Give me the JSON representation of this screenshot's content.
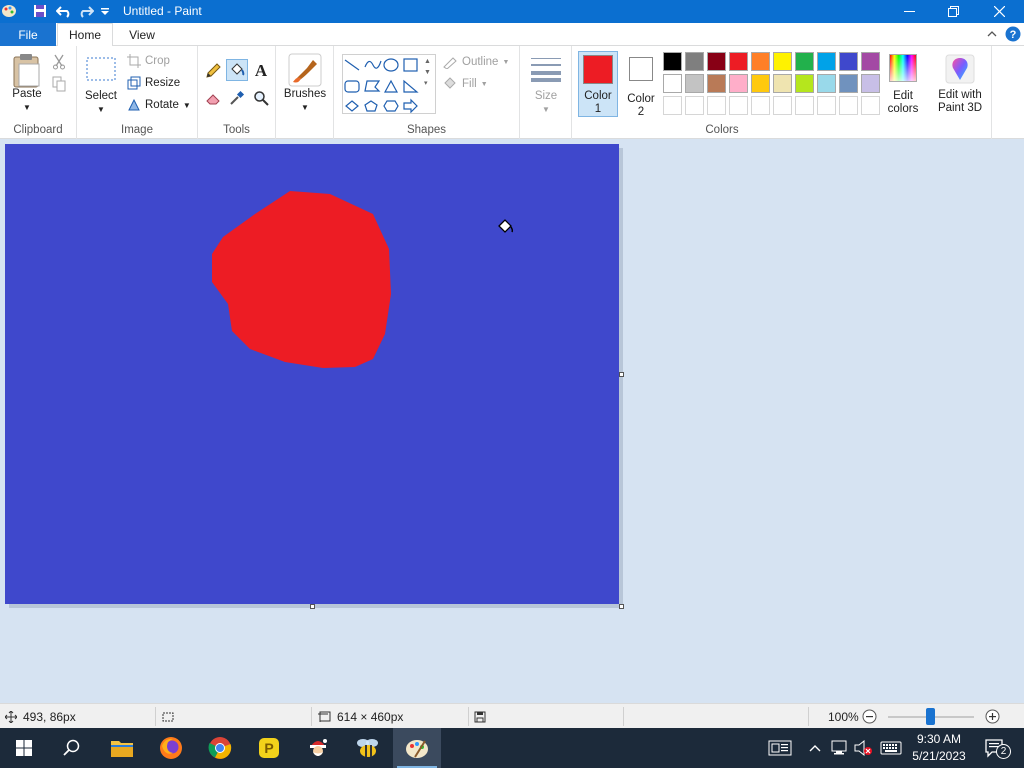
{
  "window": {
    "title": "Untitled - Paint"
  },
  "tabs": {
    "file": "File",
    "home": "Home",
    "view": "View"
  },
  "ribbon": {
    "clipboard": {
      "paste": "Paste",
      "label": "Clipboard"
    },
    "image": {
      "select": "Select",
      "crop": "Crop",
      "resize": "Resize",
      "rotate": "Rotate",
      "label": "Image"
    },
    "tools": {
      "label": "Tools",
      "selected_tool": "fill-bucket"
    },
    "brushes": {
      "label": "Brushes"
    },
    "shapes": {
      "outline": "Outline",
      "fill": "Fill",
      "label": "Shapes"
    },
    "size": {
      "label": "Size"
    },
    "colors": {
      "color1_line1": "Color",
      "color1_line2": "1",
      "color2_line1": "Color",
      "color2_line2": "2",
      "color1": "#ed1c24",
      "color2": "#ffffff",
      "edit_line1": "Edit",
      "edit_line2": "colors",
      "paint3d_line1": "Edit with",
      "paint3d_line2": "Paint 3D",
      "label": "Colors",
      "palette_row1": [
        "#000000",
        "#7f7f7f",
        "#880015",
        "#ed1c24",
        "#ff7f27",
        "#fff200",
        "#22b14c",
        "#00a2e8",
        "#3f48cc",
        "#a349a4"
      ],
      "palette_row2": [
        "#ffffff",
        "#c3c3c3",
        "#b97a57",
        "#ffaec9",
        "#ffc90e",
        "#efe4b0",
        "#b5e61d",
        "#99d9ea",
        "#7092be",
        "#c8bfe7"
      ]
    }
  },
  "canvas": {
    "background": "#3f48cc",
    "blob_color": "#ed1c24"
  },
  "status": {
    "cursor_pos": "493, 86px",
    "canvas_size": "614 × 460px",
    "zoom": "100%",
    "zoom_level": 1.0
  },
  "taskbar": {
    "time": "9:30 AM",
    "date": "5/21/2023",
    "notifications": "2"
  }
}
